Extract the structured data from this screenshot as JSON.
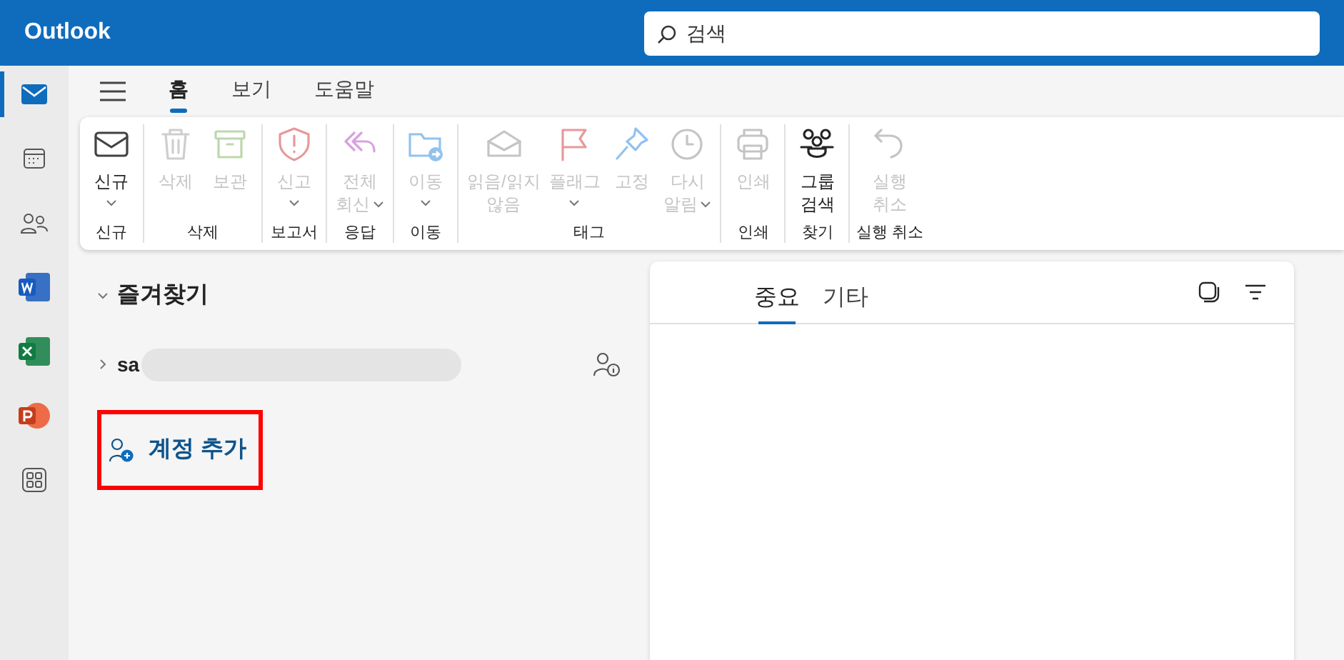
{
  "app_title": "Outlook",
  "search": {
    "placeholder": "검색"
  },
  "rail": [
    {
      "selected": true
    },
    {
      "selected": false
    },
    {
      "selected": false
    },
    {
      "selected": false
    },
    {
      "selected": false
    },
    {
      "selected": false
    },
    {
      "selected": false
    }
  ],
  "tabs": [
    {
      "label": "홈",
      "selected": true
    },
    {
      "label": "보기",
      "selected": false
    },
    {
      "label": "도움말",
      "selected": false
    }
  ],
  "ribbon": [
    {
      "group": "신규",
      "buttons": [
        {
          "lines": [
            "신규"
          ],
          "dropdown": true,
          "disabled": false
        }
      ]
    },
    {
      "group": "삭제",
      "buttons": [
        {
          "lines": [
            "삭제"
          ],
          "dropdown": false,
          "disabled": true
        },
        {
          "lines": [
            "보관"
          ],
          "dropdown": false,
          "disabled": true
        }
      ]
    },
    {
      "group": "보고서",
      "buttons": [
        {
          "lines": [
            "신고"
          ],
          "dropdown": true,
          "disabled": true
        }
      ]
    },
    {
      "group": "응답",
      "buttons": [
        {
          "lines": [
            "전체",
            "회신"
          ],
          "dropdown": true,
          "disabled": true
        }
      ]
    },
    {
      "group": "이동",
      "buttons": [
        {
          "lines": [
            "이동"
          ],
          "dropdown": true,
          "disabled": true
        }
      ]
    },
    {
      "group": "태그",
      "buttons": [
        {
          "lines": [
            "읽음/읽지",
            "않음"
          ],
          "dropdown": false,
          "disabled": true
        },
        {
          "lines": [
            "플래그"
          ],
          "dropdown": true,
          "disabled": true
        },
        {
          "lines": [
            "고정"
          ],
          "dropdown": false,
          "disabled": true
        },
        {
          "lines": [
            "다시",
            "알림"
          ],
          "dropdown": true,
          "disabled": true
        }
      ]
    },
    {
      "group": "인쇄",
      "buttons": [
        {
          "lines": [
            "인쇄"
          ],
          "dropdown": false,
          "disabled": true
        }
      ]
    },
    {
      "group": "찾기",
      "buttons": [
        {
          "lines": [
            "그룹",
            "검색"
          ],
          "dropdown": false,
          "disabled": false
        }
      ]
    },
    {
      "group": "실행 취소",
      "buttons": [
        {
          "lines": [
            "실행",
            "취소"
          ],
          "dropdown": false,
          "disabled": true
        }
      ]
    }
  ],
  "folders": {
    "favorites": {
      "label": "즐겨찾기",
      "expanded": true
    },
    "account": {
      "name": "sa",
      "expanded": false
    },
    "add_account": "계정 추가"
  },
  "inbox_tabs": [
    {
      "label": "중요",
      "selected": true
    },
    {
      "label": "기타",
      "selected": false
    }
  ]
}
